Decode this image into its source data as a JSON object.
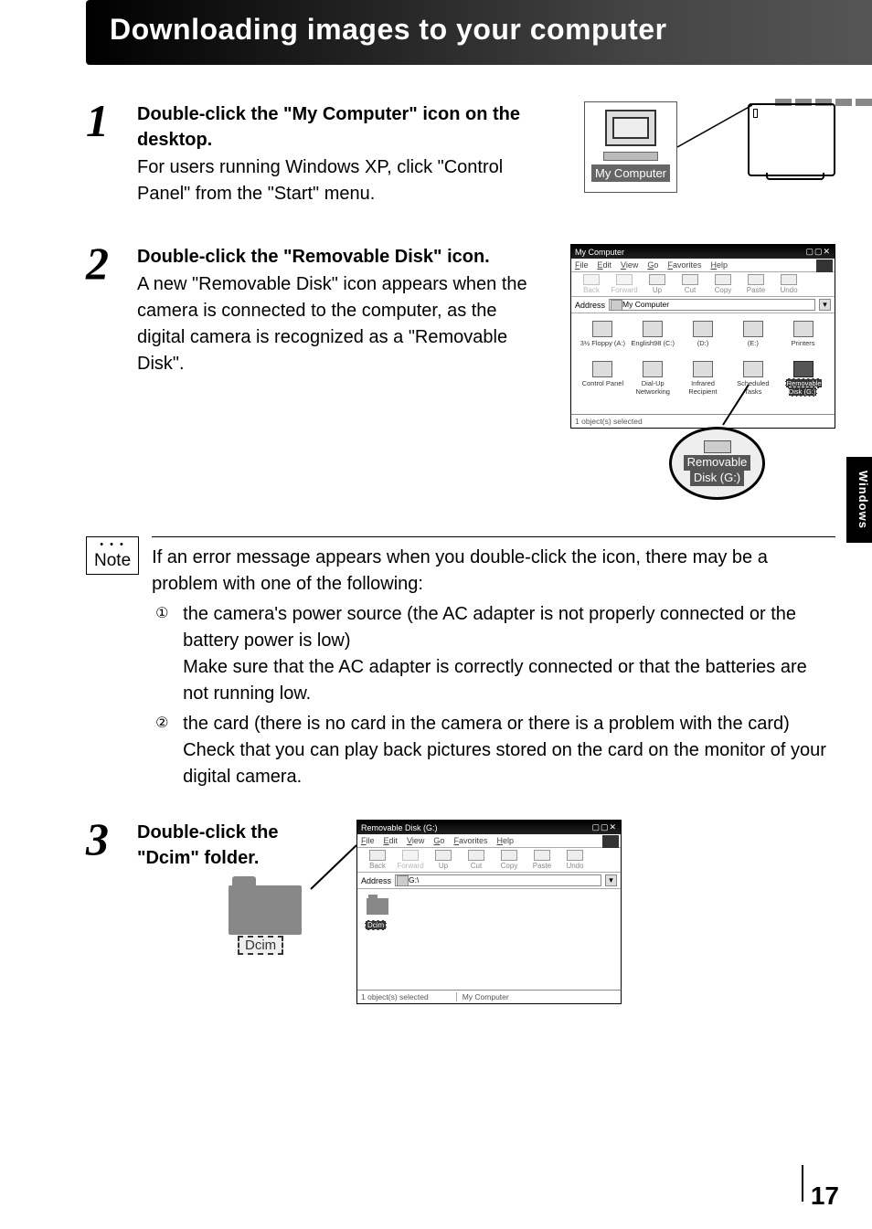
{
  "header": {
    "title": "Downloading images to your computer"
  },
  "sideTab": "Windows",
  "pageNumber": "17",
  "steps": {
    "s1": {
      "num": "1",
      "instr": "Double-click the \"My Computer\" icon on the desktop.",
      "text": "For users running Windows XP, click \"Control Panel\" from the \"Start\" menu.",
      "iconLabel": "My Computer"
    },
    "s2": {
      "num": "2",
      "instr": "Double-click the \"Removable Disk\" icon.",
      "text": "A new \"Removable Disk\" icon appears when the camera is connected to the computer, as the digital camera is recognized as a \"Removable Disk\".",
      "window": {
        "title": "My Computer",
        "menus": [
          "File",
          "Edit",
          "View",
          "Go",
          "Favorites",
          "Help"
        ],
        "tb": [
          "Back",
          "Forward",
          "Up",
          "Cut",
          "Copy",
          "Paste",
          "Undo"
        ],
        "addrLabel": "Address",
        "addrValue": "My Computer",
        "icons": [
          {
            "label": "3½ Floppy (A:)"
          },
          {
            "label": "English98 (C:)"
          },
          {
            "label": "(D:)"
          },
          {
            "label": "(E:)"
          },
          {
            "label": "Printers"
          },
          {
            "label": "Control Panel"
          },
          {
            "label": "Dial-Up Networking"
          },
          {
            "label": "Infrared Recipient"
          },
          {
            "label": "Scheduled Tasks"
          },
          {
            "label": "Removable Disk (G:)",
            "sel": true
          }
        ],
        "status": "1 object(s) selected"
      },
      "calloutLine1": "Removable",
      "calloutLine2": "Disk (G:)"
    },
    "s3": {
      "num": "3",
      "instr": "Double-click the \"Dcim\" folder.",
      "folderLabel": "Dcim",
      "smallFolderLabel": "Dcim",
      "window": {
        "title": "Removable Disk (G:)",
        "menus": [
          "File",
          "Edit",
          "View",
          "Go",
          "Favorites",
          "Help"
        ],
        "tb": [
          "Back",
          "Forward",
          "Up",
          "Cut",
          "Copy",
          "Paste",
          "Undo"
        ],
        "addrLabel": "Address",
        "addrValue": "G:\\",
        "status": "1 object(s) selected",
        "statusRight": "My Computer"
      }
    }
  },
  "note": {
    "label": "Note",
    "intro": "If an error message appears when you double-click the icon, there may be a problem with one of the following:",
    "items": [
      {
        "bullet": "①",
        "lead": "the camera's power source (the AC adapter is not properly connected or the battery power is low)",
        "sub": "Make sure that the AC adapter is correctly connected or that the batteries are not running low."
      },
      {
        "bullet": "②",
        "lead": "the card (there is no card in the camera or there is a problem with the card)",
        "sub": "Check that you can play back pictures stored on the card on the monitor of your digital camera."
      }
    ]
  }
}
